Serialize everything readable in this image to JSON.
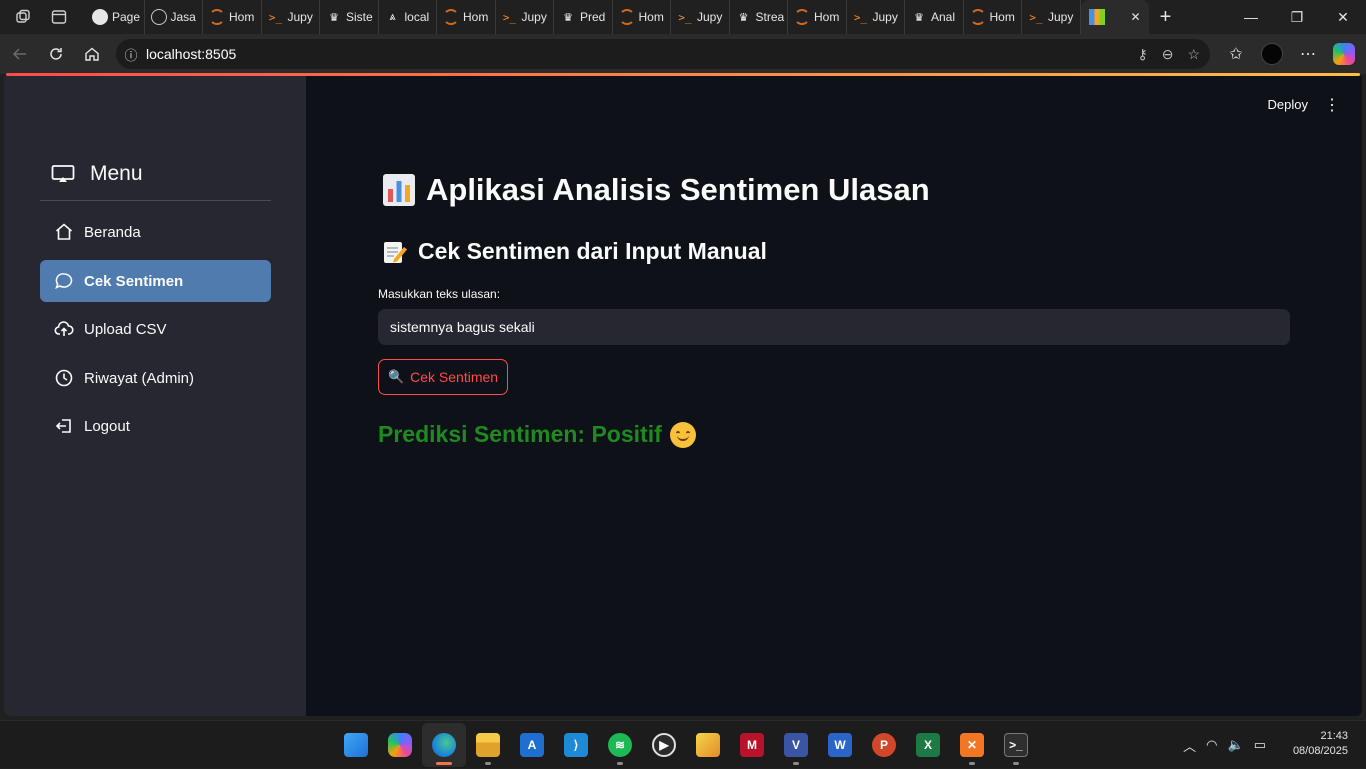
{
  "browser": {
    "tabs": [
      {
        "label": "Page",
        "icon": "github-icon"
      },
      {
        "label": "Jasa",
        "icon": "globe-icon"
      },
      {
        "label": "Hom",
        "icon": "jupyter-icon"
      },
      {
        "label": "Jupy",
        "icon": "terminal-icon"
      },
      {
        "label": "Siste",
        "icon": "streamlit-crown-icon"
      },
      {
        "label": "local",
        "icon": "streamlit-logo-icon"
      },
      {
        "label": "Hom",
        "icon": "jupyter-icon"
      },
      {
        "label": "Jupy",
        "icon": "terminal-icon"
      },
      {
        "label": "Pred",
        "icon": "streamlit-crown-icon"
      },
      {
        "label": "Hom",
        "icon": "jupyter-icon"
      },
      {
        "label": "Jupy",
        "icon": "terminal-icon"
      },
      {
        "label": "Strea",
        "icon": "streamlit-crown-icon"
      },
      {
        "label": "Hom",
        "icon": "jupyter-icon"
      },
      {
        "label": "Jupy",
        "icon": "terminal-icon"
      },
      {
        "label": "Anal",
        "icon": "streamlit-crown-icon"
      },
      {
        "label": "Hom",
        "icon": "jupyter-icon"
      },
      {
        "label": "Jupy",
        "icon": "terminal-icon"
      }
    ],
    "active_tab_close": "✕",
    "new_tab": "+",
    "address": "localhost:8505"
  },
  "app": {
    "deploy_label": "Deploy",
    "sidebar": {
      "title": "Menu",
      "items": [
        {
          "label": "Beranda",
          "icon": "home-icon",
          "active": false
        },
        {
          "label": "Cek Sentimen",
          "icon": "chat-bubble-icon",
          "active": true
        },
        {
          "label": "Upload CSV",
          "icon": "cloud-upload-icon",
          "active": false
        },
        {
          "label": "Riwayat (Admin)",
          "icon": "clock-icon",
          "active": false
        },
        {
          "label": "Logout",
          "icon": "logout-icon",
          "active": false
        }
      ]
    },
    "main": {
      "title": "Aplikasi Analisis Sentimen Ulasan",
      "title_emoji": "bar-chart-emoji",
      "subtitle": "Cek Sentimen dari Input Manual",
      "subtitle_emoji": "memo-emoji",
      "input_label": "Masukkan teks ulasan:",
      "input_value": "sistemnya bagus sekali",
      "button_label": "Cek Sentimen",
      "button_icon": "magnifier-icon",
      "result_text": "Prediksi Sentimen: Positif",
      "result_color": "#1f8a1f",
      "accent_color": "#ff4b4b",
      "active_nav_color": "#4f7bae"
    }
  },
  "taskbar": {
    "apps": [
      "windows-start-icon",
      "copilot-icon",
      "edge-icon",
      "file-explorer-icon",
      "azure-data-studio-icon",
      "vscode-icon",
      "spotify-icon",
      "media-player-icon",
      "snipping-tool-icon",
      "mendeley-icon",
      "visio-icon",
      "word-icon",
      "powerpoint-icon",
      "excel-icon",
      "xampp-icon",
      "terminal-icon"
    ],
    "time": "21:43",
    "date": "08/08/2025"
  }
}
